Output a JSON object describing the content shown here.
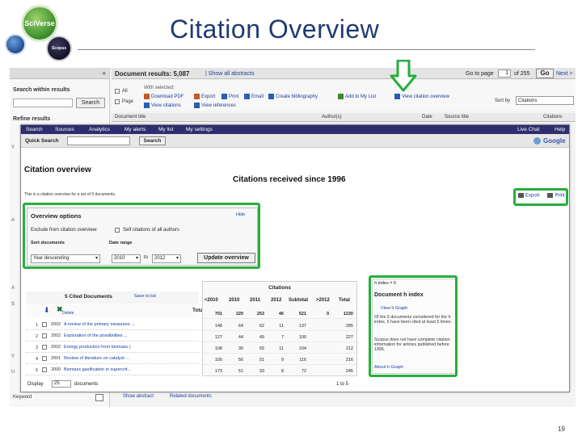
{
  "slide": {
    "title": "Citation Overview",
    "page_number": "19",
    "logos": {
      "sciverse": "SciVerse",
      "scopus": "Scopus"
    }
  },
  "background": {
    "collapse_symbol": "«",
    "search_within_label": "Search within results",
    "search_button": "Search",
    "refine_label": "Refine results",
    "keyword_label": "Keyword",
    "results_label": "Document results: 5,087",
    "show_abstracts": "| Show all abstracts",
    "go_to_page": "Go to page",
    "page_value": "1",
    "of_pages": "of 255",
    "go_button": "Go",
    "next": "Next >",
    "check_all": "All",
    "check_page": "Page",
    "with_selected": "With selected:",
    "actions": [
      {
        "label": "Download PDF",
        "color": "#c9572a"
      },
      {
        "label": "Export",
        "color": "#c9572a"
      },
      {
        "label": "Print",
        "color": "#2a5fb0"
      },
      {
        "label": "Email",
        "color": "#2a5fb0"
      },
      {
        "label": "Create bibliography",
        "color": "#2a5fb0"
      },
      {
        "label": "Add to My List",
        "color": "#3b8a2b"
      },
      {
        "label": "View citation overview",
        "color": "#2a5fb0"
      },
      {
        "label": "View citations",
        "color": "#2a5fb0"
      },
      {
        "label": "View references",
        "color": "#2a5fb0"
      }
    ],
    "sort_by": "Sort by",
    "sort_value": "Citations",
    "columns": [
      "Document title",
      "Author(s)",
      "Date",
      "Source title",
      "Citations"
    ],
    "side_letters": [
      "Y",
      "A",
      "A",
      "S",
      "Y",
      "U"
    ],
    "bottom_links": [
      "Show abstract",
      "Related documents"
    ]
  },
  "overlay": {
    "nav_items": [
      "Search",
      "Sources",
      "Analytics",
      "My alerts",
      "My list",
      "My settings"
    ],
    "nav_right": [
      "Live Chat",
      "Help"
    ],
    "quick_search_label": "Quick Search",
    "search_button": "Search",
    "google_label": "Google",
    "page_title": "Citation overview",
    "since_title": "Citations received since 1996",
    "description": "This is a citation overview for a set of 5 documents.",
    "export_label": "Export",
    "print_label": "Print",
    "options": {
      "header": "Overview options",
      "hide": "Hide",
      "exclude_label": "Exclude from citation overview:",
      "self_citations_label": "Self citations of all authors",
      "sort_label": "Sort documents",
      "date_range_label": "Date range",
      "sort_value": "Year descending",
      "from_year": "2010",
      "to_label": "to",
      "to_year": "2012",
      "update_button": "Update overview"
    },
    "cited": {
      "header": "5 Cited Documents",
      "save_link": "Save to list",
      "delete_label": "Delete",
      "total_label": "Total",
      "rows": [
        {
          "n": "1",
          "year": "2002",
          "title": "A review of the primary measures ..."
        },
        {
          "n": "2",
          "year": "2002",
          "title": "Exploration of the possibilities ..."
        },
        {
          "n": "3",
          "year": "2002",
          "title": "Energy production from biomass ("
        },
        {
          "n": "4",
          "year": "2001",
          "title": "Review of literature on catalyst ..."
        },
        {
          "n": "5",
          "year": "2000",
          "title": "Biomass gasification in supercrit..."
        }
      ]
    },
    "citations": {
      "caption": "Citations",
      "year_headers": [
        "<2010",
        "2010",
        "2011",
        "2012",
        "Subtotal",
        ">2012",
        "Total"
      ],
      "total_row": [
        "701",
        "229",
        "253",
        "46",
        "521",
        "0",
        "1230"
      ],
      "rows": [
        [
          "148",
          "64",
          "62",
          "11",
          "137",
          "",
          "285"
        ],
        [
          "127",
          "44",
          "49",
          "7",
          "100",
          "",
          "227"
        ],
        [
          "108",
          "30",
          "55",
          "11",
          "104",
          "",
          "212"
        ],
        [
          "100",
          "56",
          "51",
          "9",
          "116",
          "",
          "216"
        ],
        [
          "173",
          "51",
          "33",
          "8",
          "72",
          "",
          "245"
        ]
      ],
      "pager": "1 to 5"
    },
    "h_index": {
      "top": "h index = 5",
      "header": "Document h index",
      "view_graph": "View h Graph",
      "para1": "Of the 5 documents considered for the h index, 5 have been cited at least 5 times.",
      "para2": "Scopus does not have complete citation information for articles published before 1996.",
      "about": "About h Graph"
    },
    "bottom": {
      "display_label": "Display",
      "display_value": "25",
      "documents_label": "documents",
      "page_range": "1 to 5"
    }
  }
}
